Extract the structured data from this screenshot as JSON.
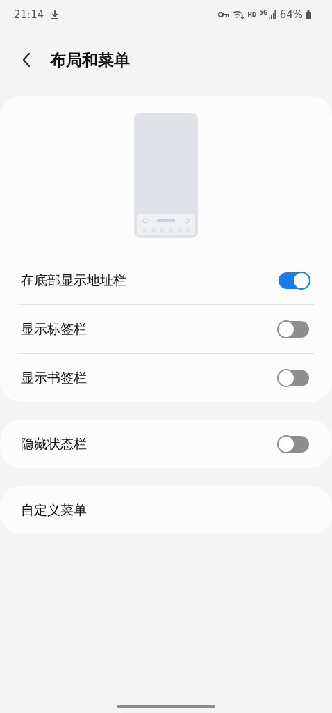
{
  "status_bar": {
    "time": "21:14",
    "hd": "HD",
    "network": "5G",
    "battery": "64%"
  },
  "header": {
    "title": "布局和菜单"
  },
  "groups": [
    {
      "preview": true,
      "rows": [
        {
          "label": "在底部显示地址栏",
          "kind": "toggle",
          "on": true
        },
        {
          "label": "显示标签栏",
          "kind": "toggle",
          "on": false
        },
        {
          "label": "显示书签栏",
          "kind": "toggle",
          "on": false
        }
      ]
    },
    {
      "preview": false,
      "rows": [
        {
          "label": "隐藏状态栏",
          "kind": "toggle",
          "on": false
        }
      ]
    },
    {
      "preview": false,
      "rows": [
        {
          "label": "自定义菜单",
          "kind": "link"
        }
      ]
    }
  ]
}
